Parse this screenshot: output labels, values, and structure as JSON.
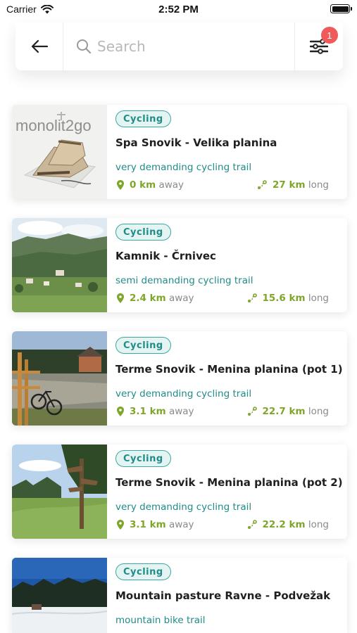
{
  "status_bar": {
    "carrier": "Carrier",
    "time": "2:52 PM"
  },
  "search": {
    "placeholder": "Search",
    "filter_count": "1"
  },
  "trails": [
    {
      "category": "Cycling",
      "title": "Spa Snovik - Velika planina",
      "difficulty": "very demanding cycling trail",
      "distance_value": "0 km",
      "distance_label": "away",
      "length_value": "27 km",
      "length_label": "long",
      "thumb_logo": "monolit2go",
      "thumb": "boots"
    },
    {
      "category": "Cycling",
      "title": "Kamnik - Črnivec",
      "difficulty": "semi demanding cycling trail",
      "distance_value": "2.4 km",
      "distance_label": "away",
      "length_value": "15.6 km",
      "length_label": "long",
      "thumb": "valley"
    },
    {
      "category": "Cycling",
      "title": "Terme Snovik - Menina planina (pot 1)",
      "difficulty": "very demanding cycling trail",
      "distance_value": "3.1 km",
      "distance_label": "away",
      "length_value": "22.7 km",
      "length_label": "long",
      "thumb": "bike"
    },
    {
      "category": "Cycling",
      "title": "Terme Snovik - Menina planina (pot 2)",
      "difficulty": "very demanding cycling trail",
      "distance_value": "3.1 km",
      "distance_label": "away",
      "length_value": "22.2 km",
      "length_label": "long",
      "thumb": "signpost"
    },
    {
      "category": "Cycling",
      "title": "Mountain pasture Ravne - Podvežak",
      "difficulty": "mountain bike trail",
      "thumb": "snow"
    }
  ],
  "colors": {
    "accent_teal": "#1f8c88",
    "value_green": "#7fa62a",
    "badge_red": "#ef5a5a"
  },
  "icons": {
    "back": "arrow-left-icon",
    "search": "search-icon",
    "filter": "filter-sliders-icon",
    "distance": "location-pin-icon",
    "length": "route-icon"
  }
}
